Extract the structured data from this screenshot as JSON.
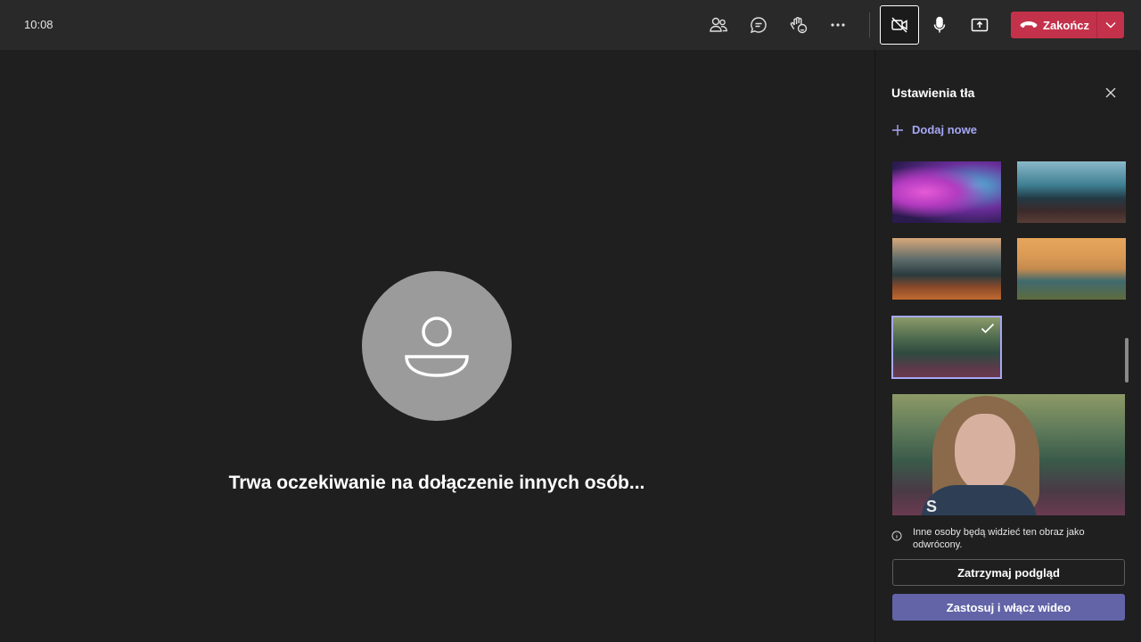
{
  "topbar": {
    "time": "10:08",
    "icons": [
      "people-icon",
      "chat-icon",
      "reactions-icon",
      "more-icon",
      "camera-off-icon",
      "microphone-icon",
      "share-icon",
      "hangup-icon",
      "chevron-down-icon"
    ],
    "end_label": "Zakończ"
  },
  "stage": {
    "waiting_text": "Trwa oczekiwanie na dołączenie innych osób..."
  },
  "panel": {
    "title": "Ustawienia tła",
    "add_new": "Dodaj nowe",
    "note": "Inne osoby będą widzieć ten obraz jako odwrócony.",
    "stop_preview": "Zatrzymaj podgląd",
    "apply": "Zastosuj i włącz wideo"
  },
  "colors": {
    "topbar": "#292929",
    "background": "#1f1f1f",
    "accent": "#6264a7",
    "accent_light": "#a6a7f5",
    "end_call": "#c4314b"
  }
}
